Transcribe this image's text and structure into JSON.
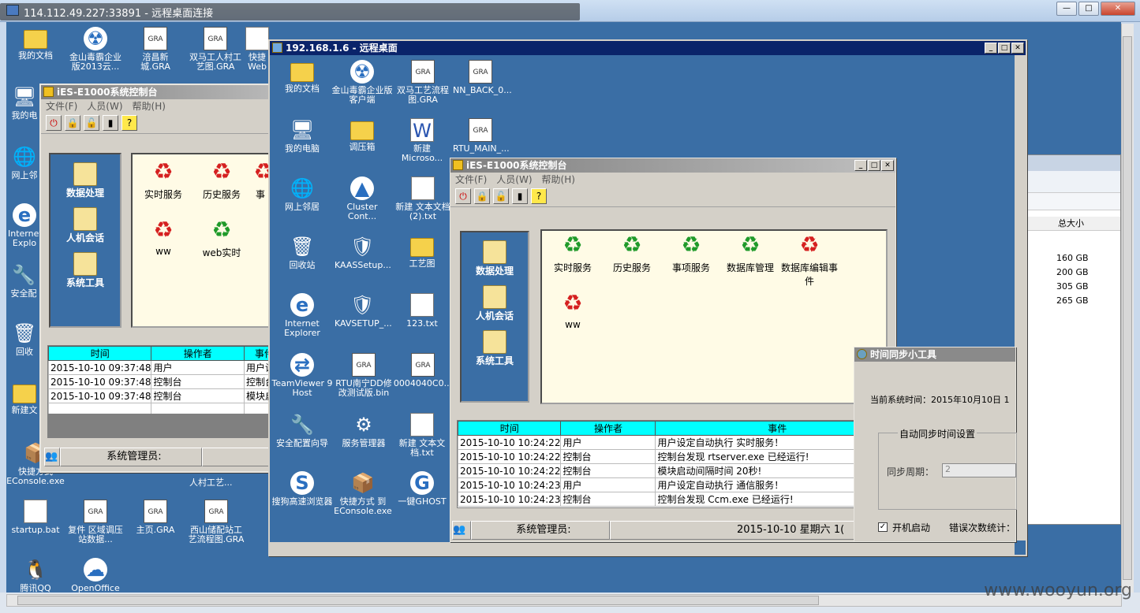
{
  "outer": {
    "title": "114.112.49.227:33891 - 远程桌面连接",
    "buttons": {
      "min": "—",
      "max": "□",
      "close": "✕"
    }
  },
  "outer_desktop": {
    "icons": [
      "我的文档",
      "金山毒霸企业版2013云...",
      "涪昌新城.GRA",
      "双马工人村工艺图.GRA",
      "快捷Web",
      "我的电",
      "网上邻",
      "Internet Explo",
      "安全配",
      "回收",
      "新建文",
      "快捷方式EConsole.exe",
      "startup.bat",
      "复件 区域调压站数据...",
      "主页.GRA",
      "西山储配站工艺流程图.GRA",
      "腾讯QQ",
      "OpenOffice",
      "人村工艺..."
    ]
  },
  "win1": {
    "title": "iES-E1000系统控制台",
    "menu": [
      "文件(F)",
      "人员(W)",
      "帮助(H)"
    ],
    "categories": [
      "数据处理",
      "人机会话",
      "系统工具"
    ],
    "services": [
      {
        "label": "实时服务",
        "state": "red"
      },
      {
        "label": "历史服务",
        "state": "red"
      },
      {
        "label": "事",
        "state": "red"
      },
      {
        "label": "ww",
        "state": "red"
      },
      {
        "label": "web实时",
        "state": "green"
      }
    ],
    "log_headers": [
      "时间",
      "操作者",
      "事件"
    ],
    "log_rows": [
      [
        "2015-10-10 09:37:48",
        "用户",
        "用户设定"
      ],
      [
        "2015-10-10 09:37:48",
        "控制台",
        "控制台"
      ],
      [
        "2015-10-10 09:37:48",
        "控制台",
        "模块启"
      ]
    ],
    "status_label": "系统管理员:"
  },
  "inner": {
    "title": "192.168.1.6 - 远程桌面",
    "icons": [
      "我的文档",
      "金山毒霸企业版客户端",
      "双马工艺流程图.GRA",
      "NN_BACK_0...",
      "我的电脑",
      "调压箱",
      "新建 Microso...",
      "RTU_MAIN_...",
      "网上邻居",
      "Cluster Cont...",
      "新建 文本文档 (2).txt",
      "回收站",
      "KAASSetup...",
      "工艺图",
      "Internet Explorer",
      "KAVSETUP_...",
      "123.txt",
      "TeamViewer 9 Host",
      "RTU南宁DD修改测试版.bin",
      "0004040C0...",
      "安全配置向导",
      "服务管理器",
      "新建 文本文档.txt",
      "搜狗高速浏览器",
      "快捷方式 到 EConsole.exe",
      "一键GHOST"
    ]
  },
  "win2": {
    "title": "iES-E1000系统控制台",
    "menu": [
      "文件(F)",
      "人员(W)",
      "帮助(H)"
    ],
    "categories": [
      "数据处理",
      "人机会话",
      "系统工具"
    ],
    "services": [
      {
        "label": "实时服务",
        "state": "green"
      },
      {
        "label": "历史服务",
        "state": "green"
      },
      {
        "label": "事项服务",
        "state": "green"
      },
      {
        "label": "数据库管理",
        "state": "green"
      },
      {
        "label": "数据库编辑事件",
        "state": "red"
      },
      {
        "label": "ww",
        "state": "red"
      }
    ],
    "log_headers": [
      "时间",
      "操作者",
      "事件"
    ],
    "log_rows": [
      [
        "2015-10-10 10:24:22",
        "用户",
        "用户设定自动执行 实时服务！"
      ],
      [
        "2015-10-10 10:24:22",
        "控制台",
        "控制台发现 rtserver.exe 已经运行!"
      ],
      [
        "2015-10-10 10:24:22",
        "控制台",
        "模块启动间隔时间 20秒!"
      ],
      [
        "2015-10-10 10:24:23",
        "用户",
        "用户设定自动执行 通信服务！"
      ],
      [
        "2015-10-10 10:24:23",
        "控制台",
        "控制台发现 Ccm.exe 已经运行!"
      ]
    ],
    "status_label": "系统管理员:",
    "status_date": "2015-10-10  星期六  1("
  },
  "sync": {
    "title": "时间同步小工具",
    "current_label": "当前系统时间：2015年10月10日 1",
    "group_label": "自动同步时间设置",
    "period_label": "同步周期：",
    "period_value": "2",
    "autostart_label": "开机启动",
    "error_label": "错误次数统计："
  },
  "bg_window": {
    "col_header": "总大小",
    "sizes": [
      "160 GB",
      "200 GB",
      "305 GB",
      "265 GB"
    ]
  },
  "watermark": "www.wooyun.org"
}
